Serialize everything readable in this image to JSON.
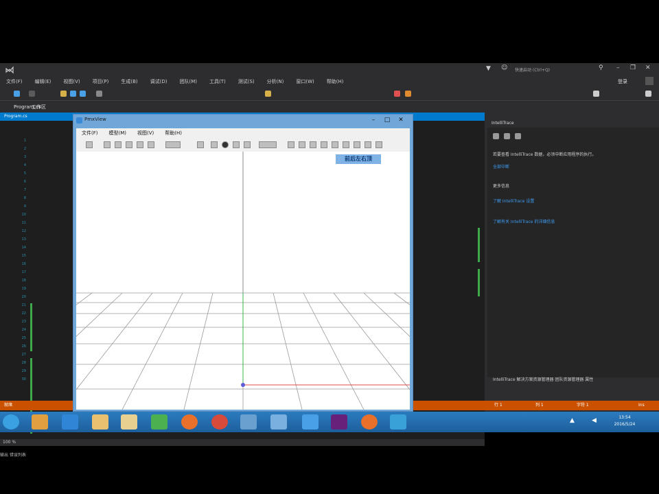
{
  "menu": [
    "文件(F)",
    "编辑(E)",
    "视图(V)",
    "项目(P)",
    "生成(B)",
    "调试(D)",
    "团队(M)",
    "工具(T)",
    "测试(S)",
    "分析(N)",
    "窗口(W)",
    "帮助(H)"
  ],
  "quick_launch_placeholder": "快速启动 (Ctrl+Q)",
  "user": "登录",
  "doc_tab": "Program.cs",
  "doc_tab_extra": "工作区",
  "line_numbers": [
    "1",
    "2",
    "3",
    "4",
    "5",
    "6",
    "7",
    "8",
    "9",
    "10",
    "11",
    "12",
    "13",
    "14",
    "15",
    "16",
    "17",
    "18",
    "19",
    "20",
    "21",
    "22",
    "23",
    "24",
    "25",
    "26",
    "27",
    "28",
    "29",
    "30"
  ],
  "zoom": "100 %",
  "output_tabs": "输出  错误列表",
  "right_panel": {
    "title": "IntelliTrace",
    "line1": "若要查看 IntelliTrace 数据，必须中断应用程序的执行。",
    "link1": "全部中断",
    "section": "更多信息",
    "link2": "了解 IntelliTrace 设置",
    "link3": "了解有关 IntelliTrace 的详细信息",
    "bottom": "IntelliTrace   解决方案资源管理器   团队资源管理器   属性"
  },
  "statusbar": {
    "left": "就绪",
    "ln": "行 1",
    "col": "列 1",
    "ch": "字符 1",
    "ins": "Ins"
  },
  "clock": {
    "time": "13:54",
    "date": "2016/5/24"
  },
  "pmx": {
    "title": "PmxView",
    "menu": [
      "文件(F)",
      "模型(M)",
      "视图(V)",
      "帮助(H)"
    ],
    "view_modes": "前后左右顶"
  }
}
